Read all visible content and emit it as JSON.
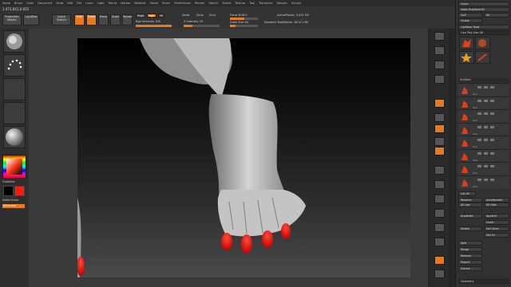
{
  "app": {
    "name": "ZBrush"
  },
  "menu": [
    "Alpha",
    "Brush",
    "Color",
    "Document",
    "Draw",
    "Edit",
    "File",
    "Layer",
    "Light",
    "Macro",
    "Marker",
    "Material",
    "Movie",
    "Picker",
    "Preferences",
    "Render",
    "Stencil",
    "Stroke",
    "Texture",
    "Tool",
    "Transform",
    "Zplugin",
    "Zscript"
  ],
  "status": {
    "coords": "1.473,641,0.655"
  },
  "toolbar": {
    "projection_master": "Projection Master",
    "lightbox": "LightBox",
    "quick_sketch": "Quick Sketch",
    "edit": "Edit",
    "draw": "Draw",
    "move": "Move",
    "scale": "Scale",
    "rotate": "Rotate",
    "mrgb": "Mrgb",
    "rgb": "Rgb",
    "m": "M",
    "zadd": "Zadd",
    "zsub": "Zsub",
    "zcut": "Zcut",
    "rgb_intensity": "Rgb Intensity 100",
    "rgb_intensity_value": 1.0,
    "z_intensity": "Z Intensity 25",
    "z_intensity_value": 0.25,
    "focal_shift": "Focal Shift 0",
    "draw_size": "Draw Size 64",
    "dynamic": "Dynamic",
    "active_points": "ActivePoints: 3,432 Mil",
    "total_points": "TotalPoints: 18.511 Mil"
  },
  "leftshelf": {
    "gradient": "Gradient",
    "switch_color": "SwitchColor",
    "alternate": "Alternate"
  },
  "rightpanel": {
    "rows": [
      "Clone",
      "Make PolyMesh3D",
      "GoZ",
      "All",
      "Visible",
      "Lightbox Tools",
      "Lion Poly Lion 48"
    ],
    "subtool_title": "SubTool",
    "subtools": [
      "Lion",
      "Lion",
      "Lion",
      "Lion",
      "Lion",
      "Lion",
      "Lion",
      "Lion"
    ],
    "list_all": "List All",
    "buttons": [
      "Rename",
      "AutoReorder",
      "All Low",
      "All High",
      "Duplicate",
      "Append",
      "Insert",
      "Delete",
      "Del Other",
      "Del All",
      "Split",
      "Merge",
      "Remesh",
      "Project",
      "Extract"
    ],
    "geometry": "Geometry"
  },
  "colors": {
    "accent": "#e87a1a",
    "primary_swatch": "#ffffff",
    "secondary_swatch": "#ff1a0d"
  }
}
